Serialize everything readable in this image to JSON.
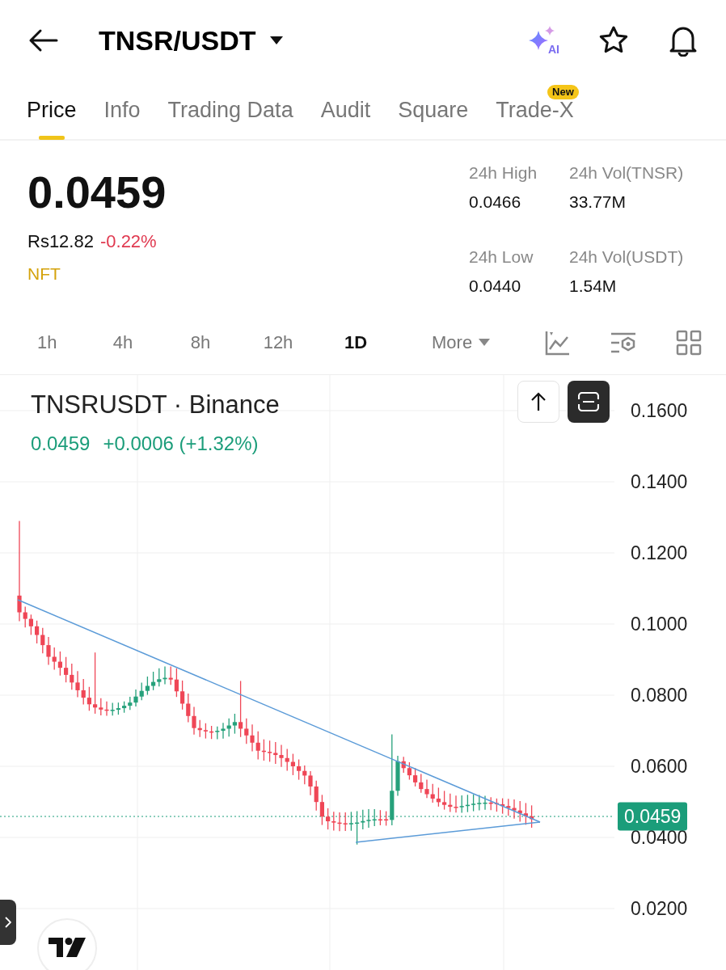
{
  "header": {
    "pair": "TNSR/USDT",
    "ai_label": "AI"
  },
  "tabs": [
    {
      "label": "Price",
      "selected": true
    },
    {
      "label": "Info",
      "selected": false
    },
    {
      "label": "Trading Data",
      "selected": false
    },
    {
      "label": "Audit",
      "selected": false
    },
    {
      "label": "Square",
      "selected": false
    },
    {
      "label": "Trade-X",
      "selected": false,
      "badge": "New"
    }
  ],
  "price": {
    "last": "0.0459",
    "fiat": "Rs12.82",
    "change": "-0.22%",
    "color": "#e0384f",
    "tag": "NFT"
  },
  "stats": [
    {
      "label": "24h High",
      "value": "0.0466"
    },
    {
      "label": "24h Vol(TNSR)",
      "value": "33.77M"
    },
    {
      "label": "24h Low",
      "value": "0.0440"
    },
    {
      "label": "24h Vol(USDT)",
      "value": "1.54M"
    }
  ],
  "intervals": [
    {
      "label": "1h",
      "selected": false
    },
    {
      "label": "4h",
      "selected": false
    },
    {
      "label": "8h",
      "selected": false
    },
    {
      "label": "12h",
      "selected": false
    },
    {
      "label": "1D",
      "selected": true
    }
  ],
  "more": "More",
  "chart": {
    "symbol": "TNSRUSDT · Binance",
    "last": "0.0459",
    "change": "+0.0006 (+1.32%)",
    "color": "#1b9d7a",
    "axis_labels": [
      "0.1600",
      "0.1400",
      "0.1200",
      "0.1000",
      "0.0800",
      "0.0600",
      "0.0400",
      "0.0200"
    ],
    "price_tag": "0.0459"
  }
}
